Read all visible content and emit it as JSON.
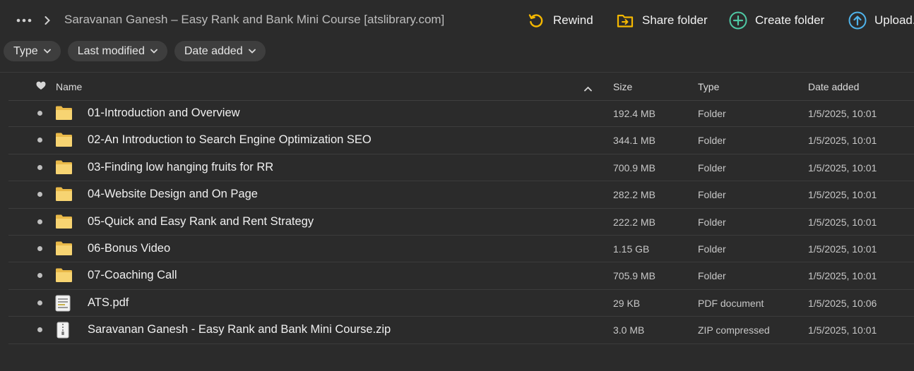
{
  "toolbar": {
    "breadcrumb": "Saravanan Ganesh – Easy Rank and Bank Mini Course [atslibrary.com]",
    "rewind": "Rewind",
    "share_folder": "Share folder",
    "create_folder": "Create folder",
    "upload": "Upload."
  },
  "filters": {
    "type": "Type",
    "last_modified": "Last modified",
    "date_added": "Date added"
  },
  "columns": {
    "name": "Name",
    "size": "Size",
    "type": "Type",
    "date_added": "Date added"
  },
  "files": [
    {
      "name": "01-Introduction and Overview",
      "size": "192.4 MB",
      "type": "Folder",
      "date": "1/5/2025, 10:01",
      "kind": "folder"
    },
    {
      "name": "02-An Introduction to Search Engine Optimization SEO",
      "size": "344.1 MB",
      "type": "Folder",
      "date": "1/5/2025, 10:01",
      "kind": "folder"
    },
    {
      "name": "03-Finding low hanging fruits for RR",
      "size": "700.9 MB",
      "type": "Folder",
      "date": "1/5/2025, 10:01",
      "kind": "folder"
    },
    {
      "name": "04-Website Design and On Page",
      "size": "282.2 MB",
      "type": "Folder",
      "date": "1/5/2025, 10:01",
      "kind": "folder"
    },
    {
      "name": "05-Quick and Easy Rank and Rent Strategy",
      "size": "222.2 MB",
      "type": "Folder",
      "date": "1/5/2025, 10:01",
      "kind": "folder"
    },
    {
      "name": "06-Bonus Video",
      "size": "1.15 GB",
      "type": "Folder",
      "date": "1/5/2025, 10:01",
      "kind": "folder"
    },
    {
      "name": "07-Coaching Call",
      "size": "705.9 MB",
      "type": "Folder",
      "date": "1/5/2025, 10:01",
      "kind": "folder"
    },
    {
      "name": "ATS.pdf",
      "size": "29 KB",
      "type": "PDF document",
      "date": "1/5/2025, 10:06",
      "kind": "pdf"
    },
    {
      "name": "Saravanan Ganesh - Easy Rank and Bank Mini Course.zip",
      "size": "3.0 MB",
      "type": "ZIP compressed",
      "date": "1/5/2025, 10:01",
      "kind": "zip"
    }
  ],
  "colors": {
    "folder": "#f5d06a",
    "rewind": "#f5b800",
    "share": "#f5b800",
    "create": "#4fc8a4",
    "upload": "#4fb3ea"
  }
}
